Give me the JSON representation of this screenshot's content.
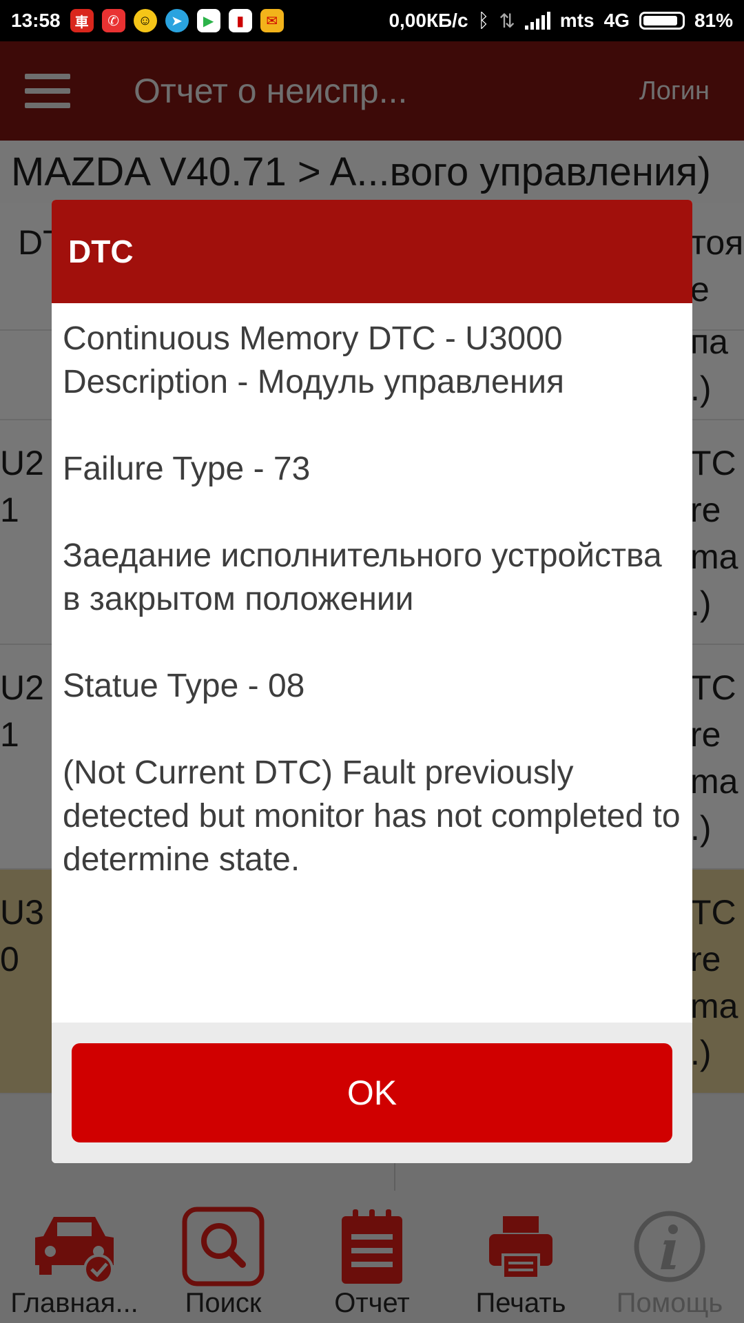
{
  "status_bar": {
    "time": "13:58",
    "network_speed": "0,00КБ/с",
    "carrier": "mts",
    "network_type": "4G",
    "battery": "81%",
    "app_icons": [
      "car-app-icon",
      "phone-icon",
      "smiley-icon",
      "telegram-icon",
      "play-store-icon",
      "app-icon",
      "mail-icon"
    ]
  },
  "app_bar": {
    "title": "Отчет о неиспр...",
    "login_label": "Логин"
  },
  "breadcrumb": "MAZDA V40.71 > A...вого управления)",
  "background_table": {
    "header_left": "DT",
    "header_right": [
      "тоя",
      "e"
    ],
    "rows": [
      {
        "left": [
          "",
          ""
        ],
        "right": [
          "па",
          ".)"
        ]
      },
      {
        "left": [
          "U2",
          "1"
        ],
        "right": [
          "TC",
          "re",
          "ma",
          ".)"
        ]
      },
      {
        "left": [
          "U2",
          "1"
        ],
        "right": [
          "TC",
          "re",
          "ma",
          ".)"
        ]
      },
      {
        "left": [
          "U3",
          "0"
        ],
        "right": [
          "TC",
          "re",
          "ma",
          ".)"
        ]
      }
    ]
  },
  "dialog": {
    "title": "DTC",
    "line1": "Continuous Memory DTC - U3000",
    "line2": "Description - Модуль управления",
    "failure_type": "Failure Type - 73",
    "failure_desc": "Заедание исполнительного устройства в закрытом положении",
    "statue_type": "Statue Type - 08",
    "statue_desc": "(Not Current DTC) Fault previously detected but monitor has not completed to determine state.",
    "ok_label": "OK"
  },
  "toolbar": {
    "home_label": "Главная...",
    "search_label": "Поиск",
    "report_label": "Отчет",
    "print_label": "Печать",
    "help_label": "Помощь"
  },
  "colors": {
    "dialog_header": "#a1100c",
    "ok_button": "#d00000",
    "dim_icon_red": "#6b0e0b"
  }
}
